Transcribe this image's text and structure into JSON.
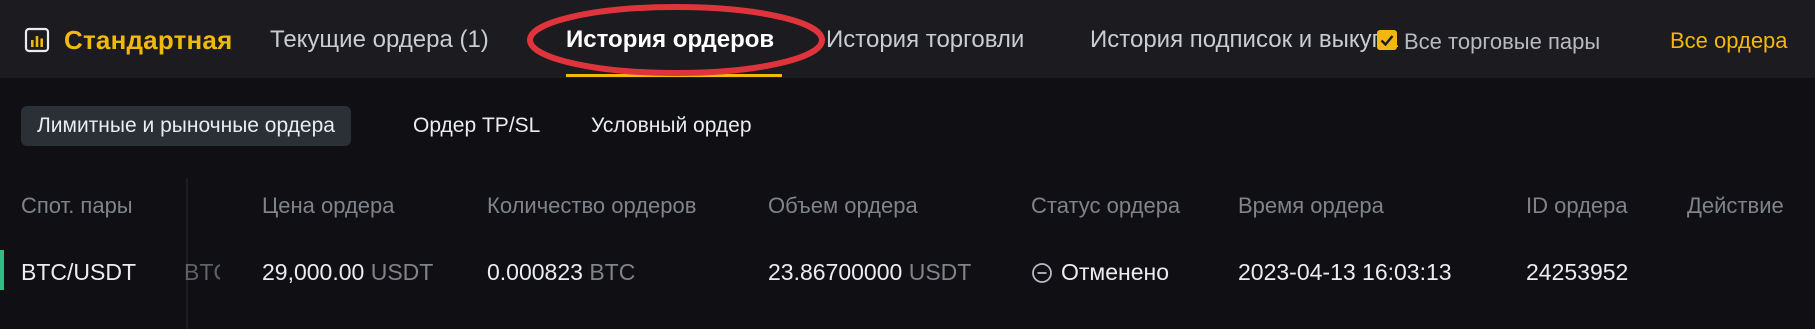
{
  "header": {
    "brand_label": "Стандартная",
    "tabs": [
      {
        "label": "Текущие ордера (1)"
      },
      {
        "label": "История ордеров"
      },
      {
        "label": "История торговли"
      },
      {
        "label": "История подписок и выкупа"
      }
    ],
    "all_pairs_label": "Все торговые пары",
    "all_orders_label": "Все ордера"
  },
  "subtabs": [
    {
      "label": "Лимитные и рыночные ордера"
    },
    {
      "label": "Ордер TP/SL"
    },
    {
      "label": "Условный ордер"
    }
  ],
  "table": {
    "columns": [
      "Спот. пары",
      "Цена ордера",
      "Количество ордеров",
      "Объем ордера",
      "Статус ордера",
      "Время ордера",
      "ID ордера",
      "Действие"
    ],
    "rows": [
      {
        "pair": "BTC/USDT",
        "ghost": "BTC",
        "price": "29,000.00",
        "price_unit": "USDT",
        "amount": "0.000823",
        "amount_unit": "BTC",
        "volume": "23.86700000",
        "volume_unit": "USDT",
        "status": "Отменено",
        "time": "2023-04-13 16:03:13",
        "id": "24253952"
      }
    ]
  },
  "colors": {
    "accent": "#f0b90b",
    "annotation": "#e0343c",
    "buy_indicator": "#2ebd85"
  }
}
